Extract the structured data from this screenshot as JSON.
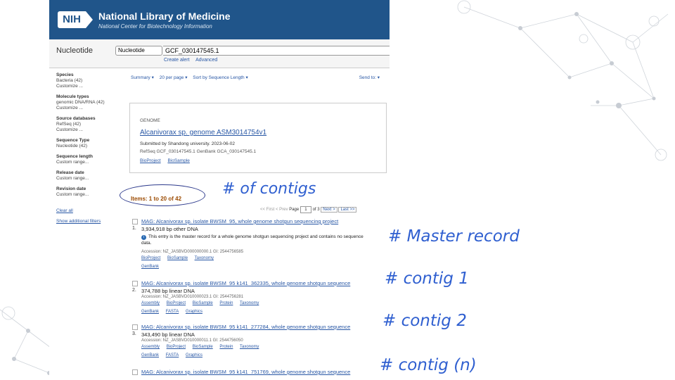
{
  "header": {
    "logo_text": "NIH",
    "title": "National Library of Medicine",
    "subtitle": "National Center for Biotechnology Information"
  },
  "search": {
    "db_label": "Nucleotide",
    "db_select": "Nucleotide",
    "query": "GCF_030147545.1",
    "links": [
      "Create alert",
      "Advanced"
    ]
  },
  "sidebar": {
    "facets": [
      {
        "heading": "Species",
        "items": [
          "Bacteria (42)",
          "Customize ..."
        ]
      },
      {
        "heading": "Molecule types",
        "items": [
          "genomic DNA/RNA (42)",
          "Customize ..."
        ]
      },
      {
        "heading": "Source databases",
        "items": [
          "RefSeq (42)",
          "Customize ..."
        ]
      },
      {
        "heading": "Sequence Type",
        "items": [
          "Nucleotide (42)"
        ]
      },
      {
        "heading": "Sequence length",
        "items": [
          "Custom range..."
        ]
      },
      {
        "heading": "Release date",
        "items": [
          "Custom range..."
        ]
      },
      {
        "heading": "Revision date",
        "items": [
          "Custom range..."
        ]
      }
    ],
    "clear_all": "Clear all",
    "show_filters": "Show additional filters"
  },
  "toolbar": {
    "summary": "Summary ▾",
    "per_page": "20 per page ▾",
    "sort": "Sort by Sequence Length ▾",
    "send_to": "Send to: ▾"
  },
  "genome_box": {
    "label": "GENOME",
    "title": "Alcanivorax sp. genome ASM3014754v1",
    "submitted": "Submitted by Shandong university. 2023-06-02",
    "refseq": "RefSeq GCF_030147545.1      GenBank GCA_030147545.1",
    "links": [
      "BioProject",
      "BioSample"
    ]
  },
  "items": "Items: 1 to 20 of 42",
  "pager": {
    "first": "<< First",
    "prev": "< Prev",
    "page_label": "Page",
    "page": "1",
    "of": "of 3",
    "next": "Next >",
    "last": "Last >>"
  },
  "results": [
    {
      "num": "1.",
      "title": "MAG: Alcanivorax sp. isolate BWSM_95, whole genome shotgun sequencing project",
      "desc": "3,934,918 bp other DNA",
      "note": "This entry is the master record for a whole genome shotgun sequencing project and contains no sequence data.",
      "acc": "Accession: NZ_JASBVD000000000.1   GI: 2544756585",
      "links": [
        "BioProject",
        "BioSample",
        "Taxonomy"
      ],
      "links2": [
        "GenBank"
      ]
    },
    {
      "num": "2.",
      "title": "MAG: Alcanivorax sp. isolate BWSM_95 k141_362335, whole genome shotgun sequence",
      "desc": "374,788 bp linear DNA",
      "acc": "Accession: NZ_JASBVD010000023.1   GI: 2544756281",
      "links": [
        "Assembly",
        "BioProject",
        "BioSample",
        "Protein",
        "Taxonomy"
      ],
      "links2": [
        "GenBank",
        "FASTA",
        "Graphics"
      ]
    },
    {
      "num": "3.",
      "title": "MAG: Alcanivorax sp. isolate BWSM_95 k141_277284, whole genome shotgun sequence",
      "desc": "343,490 bp linear DNA",
      "acc": "Accession: NZ_JASBVD010000011.1   GI: 2544756050",
      "links": [
        "Assembly",
        "BioProject",
        "BioSample",
        "Protein",
        "Taxonomy"
      ],
      "links2": [
        "GenBank",
        "FASTA",
        "Graphics"
      ]
    },
    {
      "title": "MAG: Alcanivorax sp. isolate BWSM_95 k141_751769, whole genome shotgun sequence"
    }
  ],
  "annotations": {
    "contigs": "# of contigs",
    "master": "# Master record",
    "c1": "# contig 1",
    "c2": "# contig 2",
    "cn": "# contig (n)"
  },
  "colors": {
    "header": "#20558a",
    "link": "#2857a5",
    "annotation": "#2f5fd0",
    "items": "#9b4a00"
  }
}
